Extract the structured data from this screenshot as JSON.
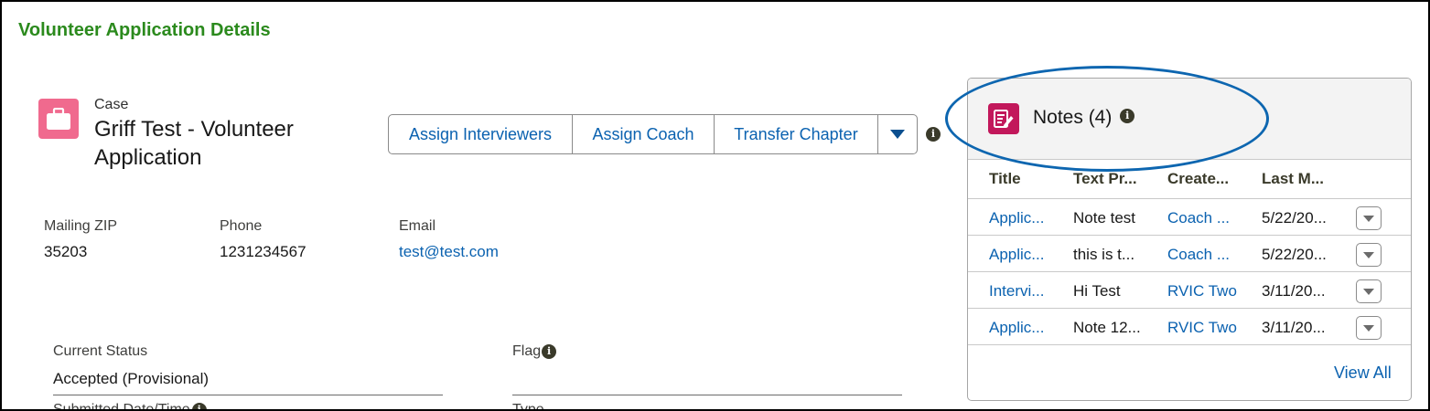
{
  "page_title": "Volunteer Application Details",
  "record": {
    "type": "Case",
    "name": "Griff Test - Volunteer Application",
    "icon": "briefcase-icon",
    "icon_color": "#f06a8e"
  },
  "actions": {
    "buttons": [
      "Assign Interviewers",
      "Assign Coach",
      "Transfer Chapter"
    ],
    "more_icon": "chevron-down-icon",
    "info_icon": "info-icon"
  },
  "highlights": [
    {
      "label": "Mailing ZIP",
      "value": "35203"
    },
    {
      "label": "Phone",
      "value": "1231234567"
    },
    {
      "label": "Email",
      "value": "test@test.com"
    }
  ],
  "details": {
    "current_status_label": "Current Status",
    "current_status_value": "Accepted (Provisional)",
    "flag_label": "Flag",
    "submitted_label": "Submitted Date/Time",
    "type_label": "Type"
  },
  "notes": {
    "title": "Notes (4)",
    "icon": "notes-icon",
    "icon_color": "#c2185b",
    "columns": [
      "Title",
      "Text Pr...",
      "Create...",
      "Last M..."
    ],
    "rows": [
      {
        "title": "Applic...",
        "text": "Note test",
        "created": "Coach ...",
        "modified": "5/22/20..."
      },
      {
        "title": "Applic...",
        "text": "this is t...",
        "created": "Coach ...",
        "modified": "5/22/20..."
      },
      {
        "title": "Intervi...",
        "text": "Hi Test",
        "created": "RVIC Two",
        "modified": "3/11/20..."
      },
      {
        "title": "Applic...",
        "text": "Note 12...",
        "created": "RVIC Two",
        "modified": "3/11/20..."
      }
    ],
    "view_all": "View All"
  },
  "colors": {
    "title_green": "#2b8a1d",
    "link_blue": "#0b62b0",
    "highlight_ellipse": "#0d66b0"
  }
}
